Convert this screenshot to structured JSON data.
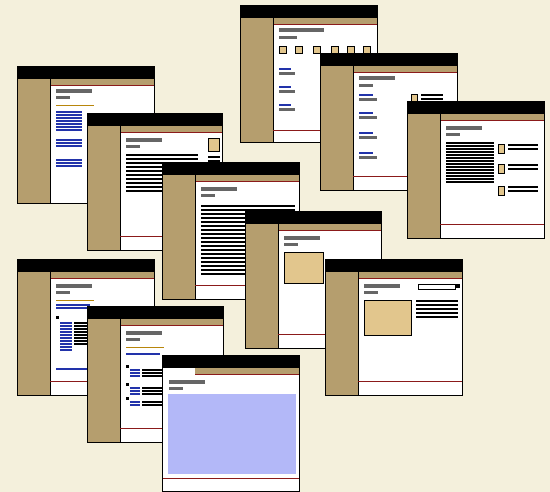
{
  "image": {
    "description_text": "",
    "background_color": "#f4f0dc",
    "colors": {
      "header": "#000000",
      "sidebar": "#b59e6e",
      "rule": "#8b1a1a",
      "placeholder_box": "#e2c68d",
      "link": "#2233aa",
      "image_area": "#b3b8f8"
    },
    "page_count": 11
  }
}
